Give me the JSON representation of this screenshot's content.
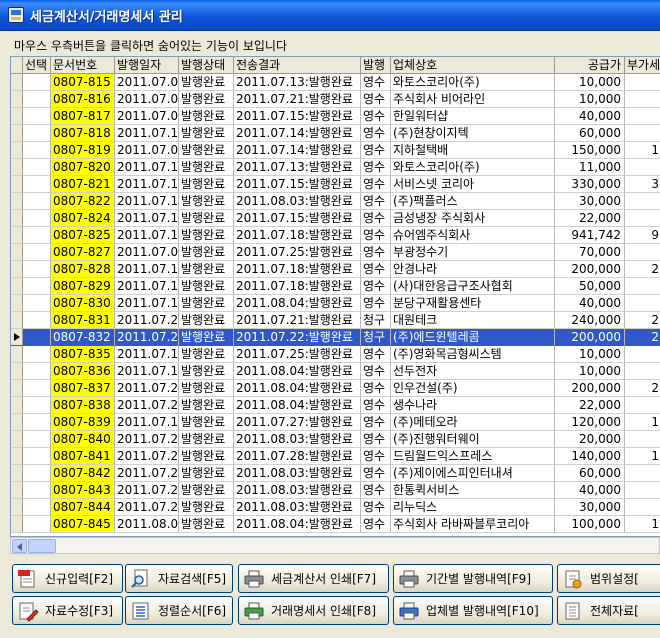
{
  "window": {
    "title": "세금계산서/거래명세서 관리"
  },
  "hint": "마우스 우측버튼을 클릭하면 숨어있는 기능이 보입니다",
  "columns": {
    "select": "선택",
    "doc_no": "문서번호",
    "issue_date": "발행일자",
    "issue_status": "발행상태",
    "transfer_result": "전송결과",
    "issue_type": "발행",
    "company": "업체상호",
    "supply_amount": "공급가",
    "vat": "부가세"
  },
  "rows": [
    {
      "doc_no": "0807-815",
      "date": "2011.07.05",
      "status": "발행완료",
      "result": "2011.07.13:발행완료",
      "type": "영수",
      "company": "와토스코리아(주)",
      "supply": "10,000",
      "vat": ""
    },
    {
      "doc_no": "0807-816",
      "date": "2011.07.05",
      "status": "발행완료",
      "result": "2011.07.21:발행완료",
      "type": "영수",
      "company": "주식회사 비어라인",
      "supply": "10,000",
      "vat": ""
    },
    {
      "doc_no": "0807-817",
      "date": "2011.07.05",
      "status": "발행완료",
      "result": "2011.07.15:발행완료",
      "type": "영수",
      "company": "한일워터샵",
      "supply": "40,000",
      "vat": ""
    },
    {
      "doc_no": "0807-818",
      "date": "2011.07.12",
      "status": "발행완료",
      "result": "2011.07.14:발행완료",
      "type": "영수",
      "company": "(주)현창이지텍",
      "supply": "60,000",
      "vat": ""
    },
    {
      "doc_no": "0807-819",
      "date": "2011.07.05",
      "status": "발행완료",
      "result": "2011.07.14:발행완료",
      "type": "영수",
      "company": "지하철택배",
      "supply": "150,000",
      "vat": "1"
    },
    {
      "doc_no": "0807-820",
      "date": "2011.07.13",
      "status": "발행완료",
      "result": "2011.07.13:발행완료",
      "type": "영수",
      "company": "와토스코리아(주)",
      "supply": "11,000",
      "vat": ""
    },
    {
      "doc_no": "0807-821",
      "date": "2011.07.11",
      "status": "발행완료",
      "result": "2011.07.15:발행완료",
      "type": "영수",
      "company": "서비스넷 코리아",
      "supply": "330,000",
      "vat": "3"
    },
    {
      "doc_no": "0807-822",
      "date": "2011.07.13",
      "status": "발행완료",
      "result": "2011.08.03:발행완료",
      "type": "영수",
      "company": "(주)팩플러스",
      "supply": "30,000",
      "vat": ""
    },
    {
      "doc_no": "0807-824",
      "date": "2011.07.14",
      "status": "발행완료",
      "result": "2011.07.15:발행완료",
      "type": "영수",
      "company": "금성냉장 주식회사",
      "supply": "22,000",
      "vat": ""
    },
    {
      "doc_no": "0807-825",
      "date": "2011.07.15",
      "status": "발행완료",
      "result": "2011.07.18:발행완료",
      "type": "영수",
      "company": "슈어엠주식회사",
      "supply": "941,742",
      "vat": "9"
    },
    {
      "doc_no": "0807-827",
      "date": "2011.07.05",
      "status": "발행완료",
      "result": "2011.07.25:발행완료",
      "type": "영수",
      "company": "부광정수기",
      "supply": "70,000",
      "vat": ""
    },
    {
      "doc_no": "0807-828",
      "date": "2011.07.18",
      "status": "발행완료",
      "result": "2011.07.18:발행완료",
      "type": "영수",
      "company": "안경나라",
      "supply": "200,000",
      "vat": "2"
    },
    {
      "doc_no": "0807-829",
      "date": "2011.07.15",
      "status": "발행완료",
      "result": "2011.07.18:발행완료",
      "type": "영수",
      "company": "(사)대한응급구조사협회",
      "supply": "50,000",
      "vat": ""
    },
    {
      "doc_no": "0807-830",
      "date": "2011.07.15",
      "status": "발행완료",
      "result": "2011.08.04:발행완료",
      "type": "영수",
      "company": "분당구재활용센타",
      "supply": "40,000",
      "vat": ""
    },
    {
      "doc_no": "0807-831",
      "date": "2011.07.20",
      "status": "발행완료",
      "result": "2011.07.21:발행완료",
      "type": "청구",
      "company": "대원테크",
      "supply": "240,000",
      "vat": "2"
    },
    {
      "doc_no": "0807-832",
      "date": "2011.07.21",
      "status": "발행완료",
      "result": "2011.07.22:발행완료",
      "type": "청구",
      "company": "(주)에드윈텔레콤",
      "supply": "200,000",
      "vat": "2",
      "selected": true
    },
    {
      "doc_no": "0807-835",
      "date": "2011.07.15",
      "status": "발행완료",
      "result": "2011.07.25:발행완료",
      "type": "영수",
      "company": "(주)영화목금형씨스템",
      "supply": "10,000",
      "vat": ""
    },
    {
      "doc_no": "0807-836",
      "date": "2011.07.15",
      "status": "발행완료",
      "result": "2011.08.04:발행완료",
      "type": "영수",
      "company": "선두전자",
      "supply": "10,000",
      "vat": ""
    },
    {
      "doc_no": "0807-837",
      "date": "2011.07.25",
      "status": "발행완료",
      "result": "2011.08.04:발행완료",
      "type": "영수",
      "company": "인우건설(주)",
      "supply": "200,000",
      "vat": "2"
    },
    {
      "doc_no": "0807-838",
      "date": "2011.07.25",
      "status": "발행완료",
      "result": "2011.08.04:발행완료",
      "type": "영수",
      "company": "생수나라",
      "supply": "22,000",
      "vat": ""
    },
    {
      "doc_no": "0807-839",
      "date": "2011.07.15",
      "status": "발행완료",
      "result": "2011.07.27:발행완료",
      "type": "영수",
      "company": "(주)메테오라",
      "supply": "120,000",
      "vat": "1"
    },
    {
      "doc_no": "0807-840",
      "date": "2011.07.25",
      "status": "발행완료",
      "result": "2011.08.03:발행완료",
      "type": "영수",
      "company": "(주)진행워터웨이",
      "supply": "20,000",
      "vat": ""
    },
    {
      "doc_no": "0807-841",
      "date": "2011.07.25",
      "status": "발행완료",
      "result": "2011.07.28:발행완료",
      "type": "영수",
      "company": "드림월드익스프레스",
      "supply": "140,000",
      "vat": "1"
    },
    {
      "doc_no": "0807-842",
      "date": "2011.07.25",
      "status": "발행완료",
      "result": "2011.08.03:발행완료",
      "type": "영수",
      "company": "(주)제이에스피인터내셔",
      "supply": "60,000",
      "vat": ""
    },
    {
      "doc_no": "0807-843",
      "date": "2011.07.27",
      "status": "발행완료",
      "result": "2011.08.03:발행완료",
      "type": "영수",
      "company": "한통퀵서비스",
      "supply": "40,000",
      "vat": ""
    },
    {
      "doc_no": "0807-844",
      "date": "2011.07.28",
      "status": "발행완료",
      "result": "2011.08.03:발행완료",
      "type": "영수",
      "company": "리누딕스",
      "supply": "30,000",
      "vat": ""
    },
    {
      "doc_no": "0807-845",
      "date": "2011.08.02",
      "status": "발행완료",
      "result": "2011.08.04:발행완료",
      "type": "영수",
      "company": "주식회사 라바짜블루코리아",
      "supply": "100,000",
      "vat": "1"
    }
  ],
  "buttons": {
    "new": "신규입력[F2]",
    "search": "자료검색[F5]",
    "tax_print": "세금계산서 인쇄[F7]",
    "period": "기간별 발행내역[F9]",
    "range": "범위설정[",
    "edit": "자료수정[F3]",
    "order": "정렬순서[F6]",
    "trade_print": "거래명세서 인쇄[F8]",
    "company": "업체별 발행내역[F10]",
    "all": "전체자료["
  },
  "icons": {
    "window": "document-app-icon",
    "new": "new-document-icon",
    "search": "search-document-icon",
    "print": "printer-icon",
    "range": "range-setting-icon",
    "edit": "edit-document-icon",
    "order": "sort-icon",
    "all": "all-data-icon"
  },
  "colors": {
    "doc_no_highlight": "#ffff00",
    "selection": "#2f59c8",
    "title_bar": "#0b52d8"
  }
}
